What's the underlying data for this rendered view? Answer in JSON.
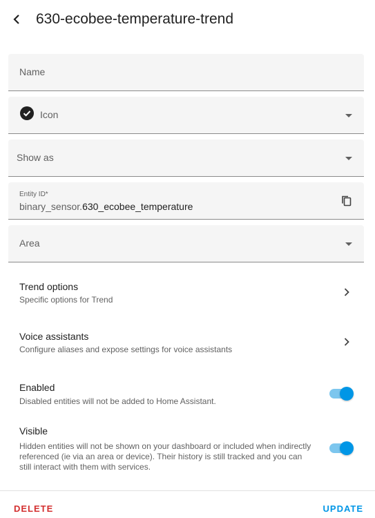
{
  "header": {
    "title": "630-ecobee-temperature-trend"
  },
  "fields": {
    "name_label": "Name",
    "icon_label": "Icon",
    "show_as_label": "Show as",
    "entity_id_label": "Entity ID*",
    "entity_id_prefix": "binary_sensor.",
    "entity_id_value": "630_ecobee_temperature",
    "area_label": "Area"
  },
  "rows": {
    "trend_title": "Trend options",
    "trend_sub": "Specific options for Trend",
    "voice_title": "Voice assistants",
    "voice_sub": "Configure aliases and expose settings for voice assistants",
    "enabled_title": "Enabled",
    "enabled_sub": "Disabled entities will not be added to Home Assistant.",
    "visible_title": "Visible",
    "visible_sub": "Hidden entities will not be shown on your dashboard or included when indirectly referenced (ie via an area or device). Their history is still tracked and you can still interact with them with services."
  },
  "toggles": {
    "enabled": true,
    "visible": true
  },
  "footer": {
    "delete_label": "DELETE",
    "update_label": "UPDATE"
  },
  "colors": {
    "accent": "#0096e6",
    "danger": "#d32f2f",
    "field_bg": "#f5f5f5"
  }
}
